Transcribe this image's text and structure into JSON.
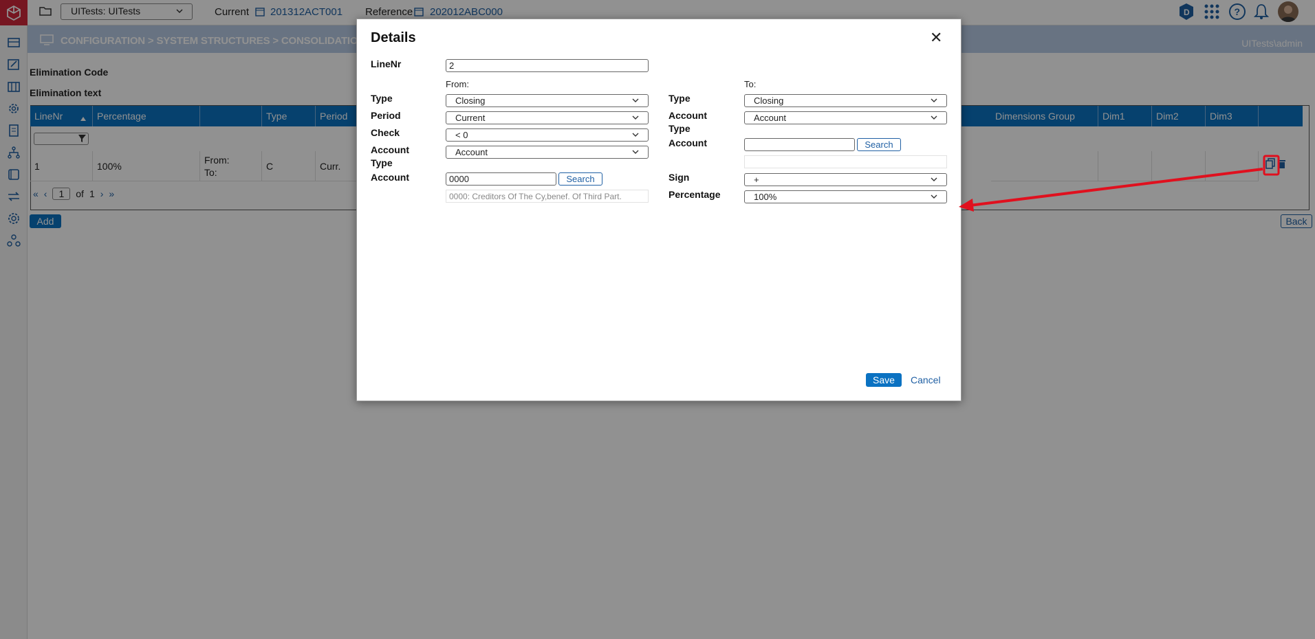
{
  "app": {
    "environment": "UITests: UITests",
    "current_label": "Current",
    "current_value": "201312ACT001",
    "reference_label": "Reference",
    "reference_value": "202012ABC000",
    "breadcrumb": "CONFIGURATION > SYSTEM STRUCTURES > CONSOLIDATION ELIM",
    "user": "UITests\\admin",
    "header_icons": [
      "d-badge-icon",
      "apps-grid-icon",
      "help-icon",
      "bell-icon",
      "user-avatar"
    ]
  },
  "rail": {
    "icons": [
      "period-icon",
      "edit-icon",
      "building-icon",
      "gear-cog-icon",
      "document-icon",
      "hierarchy-icon",
      "book-icon",
      "transfer-icon",
      "settings-icon",
      "network-icon"
    ]
  },
  "page": {
    "elimination_code_label": "Elimination Code",
    "elimination_text_label": "Elimination text",
    "columns": [
      "LineNr",
      "",
      "Percentage",
      "",
      "Type",
      "Period",
      "Dimensions Group",
      "Dim1",
      "Dim2",
      "Dim3"
    ],
    "row": {
      "linenr": "1",
      "percentage": "100%",
      "from_label": "From:",
      "to_label": "To:",
      "type": "C",
      "period": "Curr."
    },
    "pager": {
      "page": "1",
      "of_label": "of",
      "total": "1"
    },
    "add_label": "Add",
    "back_label": "Back"
  },
  "modal": {
    "title": "Details",
    "linenr_label": "LineNr",
    "linenr_value": "2",
    "from_header": "From:",
    "to_header": "To:",
    "from": {
      "type_label": "Type",
      "type_value": "Closing",
      "period_label": "Period",
      "period_value": "Current",
      "check_label": "Check",
      "check_value": "< 0",
      "account_type_label": "Account Type",
      "account_type_value": "Account",
      "account_label": "Account",
      "account_value": "0000",
      "search_label": "Search",
      "account_description": "0000: Creditors Of The Cy,benef. Of Third Part."
    },
    "to": {
      "type_label": "Type",
      "type_value": "Closing",
      "account_type_label": "Account Type",
      "account_type_value": "Account",
      "account_label": "Account",
      "account_value": "",
      "search_label": "Search",
      "sign_label": "Sign",
      "sign_value": "+",
      "percentage_label": "Percentage",
      "percentage_value": "100%"
    },
    "save_label": "Save",
    "cancel_label": "Cancel"
  },
  "colors": {
    "brand_red": "#d0283a",
    "header_blue": "#0b72c2",
    "link_blue": "#1f5fa3",
    "annotation_red": "#e0101e"
  }
}
